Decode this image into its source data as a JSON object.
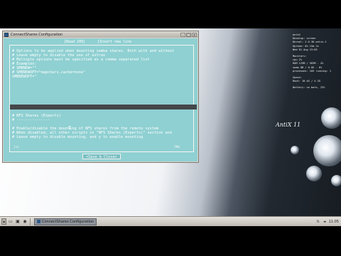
{
  "window": {
    "title": "ConnectShares Configuration"
  },
  "editor": {
    "hint_left": "[Read 289]",
    "hint_right": "[Insert new line",
    "lines": [
      "# Options to be applied when mounting samba shares. Both with and without",
      "# Leave empty to disable the use of extras",
      "# Multiple options must be specified as a comma separated list",
      "# Examples:",
      "#   SMBNEW=\"\"",
      "#   SMBNEWOPT=\"mapchars,cache=none\"",
      "SMBNEWOPT=\"",
      "",
      "",
      "",
      "# NFS Shares (Experts)",
      "# ---------------",
      "",
      "# Enable/disable the mounting of NFS shares from the remote system",
      "# When disabled, all other scripts in \"NFS Shares (Experts)\" section and",
      "# Leave empty to disable mounting, and y to enable mounting"
    ],
    "status_left": "(+)",
    "status_right": "79%",
    "save_button": "<Save & Close>"
  },
  "conky": {
    "lines": [
      "antiX",
      "Desktop: screen",
      "Kernel: 2.6.36-antix.1",
      "Uptime: 0h 15m 2s",
      "Wed 01 Aug 23:05",
      "",
      "Monitors:",
      "cpu 2%",
      "RAM 125M / 503M - 4%",
      "swap 0B / 0.0G - 0%",
      "processes: 105 running: 1",
      "",
      "Space:",
      "Root: 10.4G / 4.3G",
      "",
      "Battery: no bats, 23%"
    ]
  },
  "wallpaper": {
    "logo": "AntiX 11"
  },
  "taskbar": {
    "task_label": "ConnectShares Configuration",
    "clock": "11:05"
  }
}
